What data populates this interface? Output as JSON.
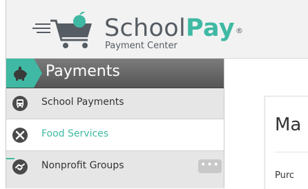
{
  "header": {
    "brand_school": "School",
    "brand_pay": "Pay",
    "brand_reg": "®",
    "tagline": "Payment Center"
  },
  "sidebar": {
    "section_title": "Payments",
    "items": [
      {
        "label": "School Payments",
        "icon": "bus-icon",
        "active": false
      },
      {
        "label": "Food Services",
        "icon": "utensils-icon",
        "active": true
      },
      {
        "label": "Nonprofit Groups",
        "icon": "handshake-icon",
        "active": false
      }
    ],
    "more_label": "•••"
  },
  "main": {
    "card_title": "Ma",
    "card_label": "Purc"
  },
  "colors": {
    "accent": "#3fb9a3",
    "text_dark": "#555c63",
    "header_bg": "#f2f2f2"
  }
}
